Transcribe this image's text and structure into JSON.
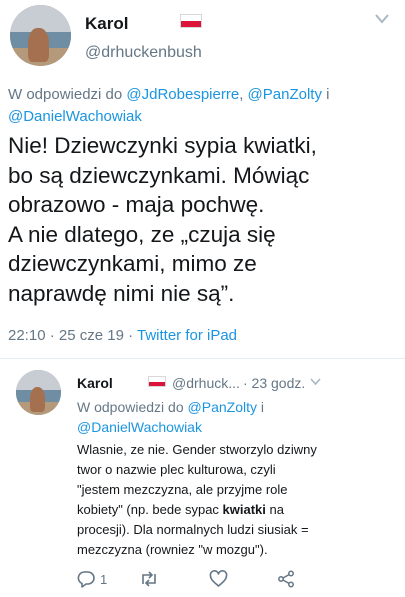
{
  "main_tweet": {
    "author_name": "Karol",
    "handle": "@drhuckenbush",
    "reply_prefix": "W odpowiedzi do",
    "reply_user_1": "@JdRobespierre",
    "reply_sep_1": ", ",
    "reply_user_2": "@PanZolty",
    "reply_sep_2": " i",
    "reply_user_3": "@DanielWachowiak",
    "text_lines": [
      "Nie! Dziewczynki sypia kwiatki,",
      "bo są dziewczynkami. Mówiąc",
      "obrazowo - maja pochwę.",
      "A nie dlatego, ze „czuja się",
      "dziewczynkami, mimo ze",
      "naprawdę nimi nie są”."
    ],
    "timestamp": "22:10 · 25 cze 19 · ",
    "source": "Twitter for iPad"
  },
  "reply_tweet": {
    "author_name": "Karol",
    "handle": "@drhuck...",
    "time": "· 23 godz.",
    "reply_prefix": "W odpowiedzi do",
    "reply_user_1": "@PanZolty",
    "reply_sep": " i",
    "reply_user_2": "@DanielWachowiak",
    "text_lines": [
      "Wlasnie, ze nie. Gender stworzylo dziwny",
      "twor o nazwie plec kulturowa, czyli",
      "\"jestem mezczyzna, ale przyjme role",
      "kobiety\" (np. bede sypac ",
      "kwiatki",
      " na",
      "procesji). Dla normalnych ludzi siusiak =",
      "mezczyzna (rowniez \"w mozgu\")."
    ],
    "reply_count": "1"
  },
  "icons": {
    "chevron": "chevron-down-icon",
    "reply": "reply-icon",
    "retweet": "retweet-icon",
    "like": "heart-icon",
    "share": "share-icon"
  },
  "colors": {
    "link": "#1b95e0",
    "secondary": "#657786",
    "flag_red": "#dc143c"
  }
}
